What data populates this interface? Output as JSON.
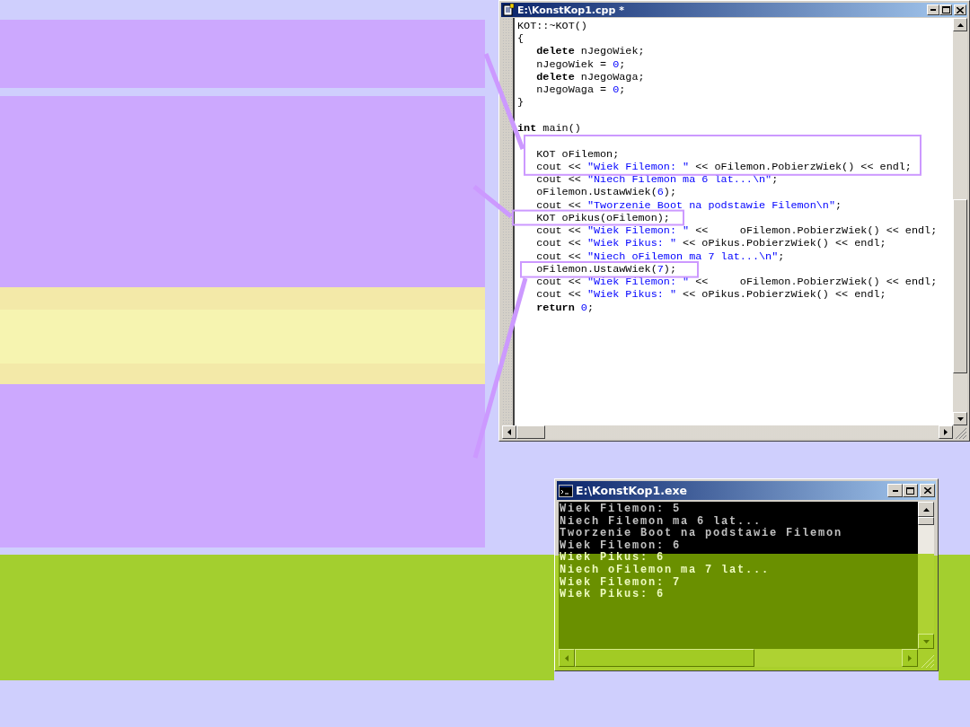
{
  "editor": {
    "title": "E:\\KonstKop1.cpp *",
    "lines": [
      {
        "kind": "code",
        "segments": [
          {
            "kind": "plain",
            "text": "KOT::~KOT()"
          }
        ]
      },
      {
        "kind": "code",
        "segments": [
          {
            "kind": "plain",
            "text": "{"
          }
        ]
      },
      {
        "kind": "code",
        "segments": [
          {
            "kind": "keyword",
            "text": "   delete"
          },
          {
            "kind": "plain",
            "text": " nJegoWiek;"
          }
        ]
      },
      {
        "kind": "code",
        "segments": [
          {
            "kind": "plain",
            "text": "   nJegoWiek = "
          },
          {
            "kind": "number",
            "text": "0"
          },
          {
            "kind": "plain",
            "text": ";"
          }
        ]
      },
      {
        "kind": "code",
        "segments": [
          {
            "kind": "keyword",
            "text": "   delete"
          },
          {
            "kind": "plain",
            "text": " nJegoWaga;"
          }
        ]
      },
      {
        "kind": "code",
        "segments": [
          {
            "kind": "plain",
            "text": "   nJegoWaga = "
          },
          {
            "kind": "number",
            "text": "0"
          },
          {
            "kind": "plain",
            "text": ";"
          }
        ]
      },
      {
        "kind": "code",
        "segments": [
          {
            "kind": "plain",
            "text": "}"
          }
        ]
      },
      {
        "kind": "blank"
      },
      {
        "kind": "code",
        "segments": [
          {
            "kind": "keyword",
            "text": "int"
          },
          {
            "kind": "plain",
            "text": " main()"
          }
        ]
      },
      {
        "kind": "blank"
      },
      {
        "kind": "code",
        "segments": [
          {
            "kind": "plain",
            "text": "   KOT oFilemon;"
          }
        ]
      },
      {
        "kind": "code",
        "segments": [
          {
            "kind": "plain",
            "text": "   cout << "
          },
          {
            "kind": "string",
            "text": "\"Wiek Filemon: \""
          },
          {
            "kind": "plain",
            "text": " << oFilemon.PobierzWiek() << endl;"
          }
        ]
      },
      {
        "kind": "code",
        "segments": [
          {
            "kind": "plain",
            "text": "   cout << "
          },
          {
            "kind": "string",
            "text": "\"Niech Filemon ma 6 lat...\\n\""
          },
          {
            "kind": "plain",
            "text": ";"
          }
        ]
      },
      {
        "kind": "code",
        "segments": [
          {
            "kind": "plain",
            "text": "   oFilemon.UstawWiek("
          },
          {
            "kind": "number",
            "text": "6"
          },
          {
            "kind": "plain",
            "text": ");"
          }
        ]
      },
      {
        "kind": "code",
        "segments": [
          {
            "kind": "plain",
            "text": "   cout << "
          },
          {
            "kind": "string",
            "text": "\"Tworzenie Boot na podstawie Filemon\\n\""
          },
          {
            "kind": "plain",
            "text": ";"
          }
        ]
      },
      {
        "kind": "code",
        "segments": [
          {
            "kind": "plain",
            "text": "   KOT oPikus(oFilemon);"
          }
        ]
      },
      {
        "kind": "code",
        "segments": [
          {
            "kind": "plain",
            "text": "   cout << "
          },
          {
            "kind": "string",
            "text": "\"Wiek Filemon: \""
          },
          {
            "kind": "plain",
            "text": " <<     oFilemon.PobierzWiek() << endl;"
          }
        ]
      },
      {
        "kind": "code",
        "segments": [
          {
            "kind": "plain",
            "text": "   cout << "
          },
          {
            "kind": "string",
            "text": "\"Wiek Pikus: \""
          },
          {
            "kind": "plain",
            "text": " << oPikus.PobierzWiek() << endl;"
          }
        ]
      },
      {
        "kind": "code",
        "segments": [
          {
            "kind": "plain",
            "text": "   cout << "
          },
          {
            "kind": "string",
            "text": "\"Niech oFilemon ma 7 lat...\\n\""
          },
          {
            "kind": "plain",
            "text": ";"
          }
        ]
      },
      {
        "kind": "code",
        "segments": [
          {
            "kind": "plain",
            "text": "   oFilemon.UstawWiek("
          },
          {
            "kind": "number",
            "text": "7"
          },
          {
            "kind": "plain",
            "text": ");"
          }
        ]
      },
      {
        "kind": "code",
        "segments": [
          {
            "kind": "plain",
            "text": "   cout << "
          },
          {
            "kind": "string",
            "text": "\"Wiek Filemon: \""
          },
          {
            "kind": "plain",
            "text": " <<     oFilemon.PobierzWiek() << endl;"
          }
        ]
      },
      {
        "kind": "code",
        "segments": [
          {
            "kind": "plain",
            "text": "   cout << "
          },
          {
            "kind": "string",
            "text": "\"Wiek Pikus: \""
          },
          {
            "kind": "plain",
            "text": " << oPikus.PobierzWiek() << endl;"
          }
        ]
      },
      {
        "kind": "code",
        "segments": [
          {
            "kind": "keyword",
            "text": "   return"
          },
          {
            "kind": "number",
            "text": " 0"
          },
          {
            "kind": "plain",
            "text": ";"
          }
        ]
      }
    ]
  },
  "console": {
    "title": "E:\\KonstKop1.exe",
    "lines": [
      "Wiek Filemon: 5",
      "Niech Filemon ma 6 lat...",
      "Tworzenie Boot na podstawie Filemon",
      "Wiek Filemon: 6",
      "Wiek Pikus: 6",
      "Niech oFilemon ma 7 lat...",
      "Wiek Filemon: 7",
      "Wiek Pikus: 6"
    ]
  }
}
